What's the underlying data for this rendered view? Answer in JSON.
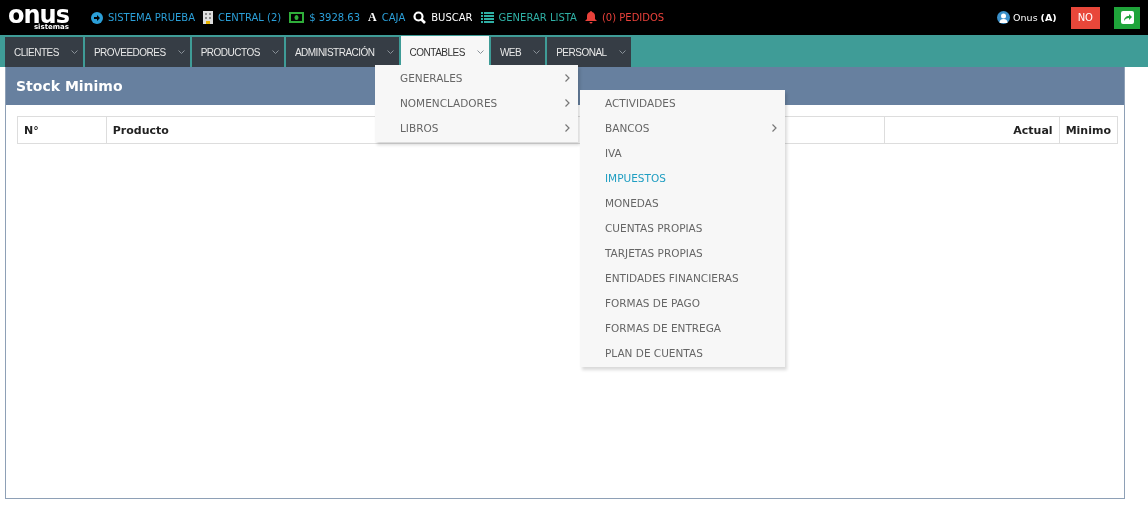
{
  "logo": {
    "name": "onus",
    "tagline": "sistemas"
  },
  "topbar": {
    "items": [
      {
        "kind": "circle-arrow",
        "label": "SISTEMA PRUEBA",
        "color": "#2b9fd8"
      },
      {
        "kind": "building",
        "label": "CENTRAL (2)",
        "color": "#2b9fd8"
      },
      {
        "kind": "money",
        "label": "$ 3928.63",
        "color": "#2b9fd8"
      },
      {
        "kind": "letter",
        "icon_text": "A",
        "label": "CAJA",
        "color": "#2b9fd8"
      },
      {
        "kind": "search",
        "label": "BUSCAR",
        "color": "#ffffff"
      },
      {
        "kind": "list",
        "label": "GENERAR LISTA",
        "color": "#2fb0a5"
      },
      {
        "kind": "bell",
        "label": "(0) PEDIDOS",
        "color": "#e8413a"
      }
    ],
    "user": "Onus",
    "user_role": "(A)",
    "no_button": "NO"
  },
  "nav": [
    {
      "label": "CLIENTES",
      "selected": false
    },
    {
      "label": "PROVEEDORES",
      "selected": false
    },
    {
      "label": "PRODUCTOS",
      "selected": false
    },
    {
      "label": "ADMINISTRACIÓN",
      "selected": false
    },
    {
      "label": "CONTABLES",
      "selected": true
    },
    {
      "label": "WEB",
      "selected": false
    },
    {
      "label": "PERSONAL",
      "selected": false
    }
  ],
  "menu": [
    {
      "label": "GENERALES",
      "submenu": true
    },
    {
      "label": "NOMENCLADORES",
      "submenu": true
    },
    {
      "label": "LIBROS",
      "submenu": true
    }
  ],
  "submenu": [
    {
      "label": "ACTIVIDADES",
      "submenu": false,
      "selected": false
    },
    {
      "label": "BANCOS",
      "submenu": true,
      "selected": false
    },
    {
      "label": "IVA",
      "submenu": false,
      "selected": false
    },
    {
      "label": "IMPUESTOS",
      "submenu": false,
      "selected": true
    },
    {
      "label": "MONEDAS",
      "submenu": false,
      "selected": false
    },
    {
      "label": "CUENTAS PROPIAS",
      "submenu": false,
      "selected": false
    },
    {
      "label": "TARJETAS PROPIAS",
      "submenu": false,
      "selected": false
    },
    {
      "label": "ENTIDADES FINANCIERAS",
      "submenu": false,
      "selected": false
    },
    {
      "label": "FORMAS DE PAGO",
      "submenu": false,
      "selected": false
    },
    {
      "label": "FORMAS DE ENTREGA",
      "submenu": false,
      "selected": false
    },
    {
      "label": "PLAN DE CUENTAS",
      "submenu": false,
      "selected": false
    }
  ],
  "panel": {
    "title": "Stock Minimo",
    "table": {
      "columns": [
        {
          "label": "N°"
        },
        {
          "label": "Producto"
        },
        {
          "label": "Actual"
        },
        {
          "label": "Minimo"
        }
      ]
    }
  }
}
